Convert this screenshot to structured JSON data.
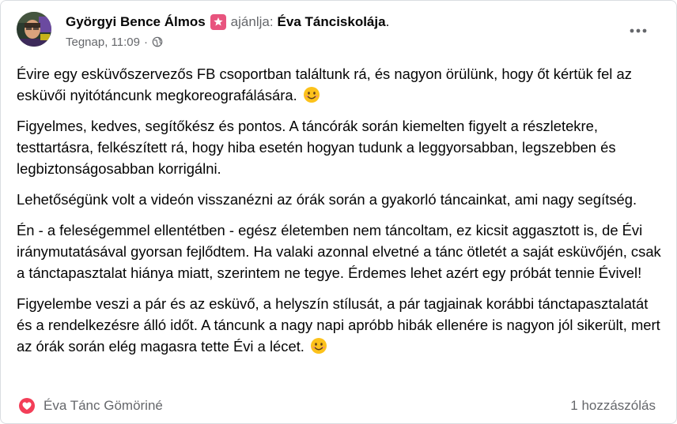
{
  "post": {
    "author": "Györgyi Bence Álmos",
    "recommends_label": "ajánlja:",
    "page_name": "Éva Tánciskolája",
    "trailing_dot": ".",
    "timestamp": "Tegnap, 11:09",
    "separator": "·",
    "audience_icon": "globe-icon",
    "badge_icon": "recommend-icon",
    "menu_icon": "more-options-icon",
    "paragraphs": [
      "Évire egy esküvőszervezős FB csoportban találtunk rá, és nagyon örülünk, hogy őt kértük fel az esküvői nyitótáncunk megkoreografálására.",
      "Figyelmes, kedves, segítőkész és pontos. A táncórák során kiemelten figyelt a részletekre, testtartásra, felkészített rá, hogy hiba esetén hogyan tudunk a leggyorsabban, legszebben és legbiztonságosabban korrigálni.",
      "Lehetőségünk volt a videón visszanézni az órák során a gyakorló táncainkat, ami nagy segítség.",
      "Én - a feleségemmel ellentétben - egész életemben nem táncoltam, ez kicsit aggasztott is, de Évi iránymutatásával gyorsan fejlődtem. Ha valaki azonnal elvetné a tánc ötletét a saját esküvőjén, csak a tánctapasztalat hiánya miatt, szerintem ne tegye. Érdemes lehet azért egy próbát tennie Évivel!",
      "Figyelembe veszi a pár és az esküvő, a helyszín stílusát, a pár tagjainak korábbi tánctapasztalatát és a rendelkezésre álló időt. A táncunk a nagy napi apróbb hibák ellenére is nagyon jól sikerült, mert az órák során elég magasra tette Évi a lécet."
    ]
  },
  "footer": {
    "reaction_icon": "heart-reaction-icon",
    "reactor_name": "Éva Tánc Gömöriné",
    "comments_count": "1 hozzászólás"
  },
  "colors": {
    "text_primary": "#050505",
    "text_secondary": "#65676b",
    "badge": "#e8547e",
    "heart": "#f33e58"
  }
}
